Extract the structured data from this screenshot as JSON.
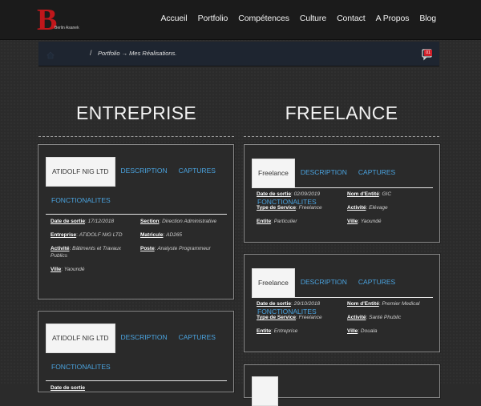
{
  "logo": {
    "mark": "B",
    "text": "Berlin Asanek"
  },
  "nav": [
    "Accueil",
    "Portfolio",
    "Compétences",
    "Culture",
    "Contact",
    "A Propos",
    "Blog"
  ],
  "breadcrumb": {
    "sep": "/",
    "path": "Portfolio → Mes Réalisations.",
    "badge": "01"
  },
  "columns": {
    "left": "ENTREPRISE",
    "right": "FREELANCE"
  },
  "tabs": {
    "enterprise": [
      "ATIDOLF NIG LTD",
      "DESCRIPTION",
      "CAPTURES",
      "FONCTIONALITES"
    ],
    "freelance": [
      "Freelance",
      "DESCRIPTION",
      "CAPTURES",
      "FONCTIONALITES"
    ]
  },
  "enterprise_card_1": {
    "date_label": "Date de sortie",
    "date": "17/12/2018",
    "section_label": "Section",
    "section": "Direction Administrative",
    "entreprise_label": "Entreprise",
    "entreprise": "ATIDOLF NIG LTD",
    "matricule_label": "Matricule",
    "matricule": "AD265",
    "activite_label": "Activité",
    "activite": "Bâtiments et Travaux Publics",
    "poste_label": "Poste",
    "poste": "Analyste Programmeur",
    "ville_label": "Ville",
    "ville": "Yaoundé"
  },
  "enterprise_card_2": {
    "date_label": "Date de sortie"
  },
  "freelance_card_1": {
    "date_label": "Date de sortie",
    "date": "02/09/2019",
    "nom_label": "Nom d'Entité",
    "nom": "GIC",
    "type_label": "Type de Service",
    "type": "Freelance",
    "activite_label": "Activité",
    "activite": "Elévage",
    "entite_label": "Entite",
    "entite": "Particulier",
    "ville_label": "Ville",
    "ville": "Yaoundé"
  },
  "freelance_card_2": {
    "date_label": "Date de sortie",
    "date": "29/10/2018",
    "nom_label": "Nom d'Entité",
    "nom": "Premier Medical",
    "type_label": "Type de Service",
    "type": "Freelance",
    "activite_label": "Activité",
    "activite": "Santé Phublic",
    "entite_label": "Entite",
    "entite": "Entreprise",
    "ville_label": "Ville",
    "ville": "Douala"
  },
  "colors": {
    "nav_bg": "#1b1b1b",
    "logo_red": "#c0171b",
    "tab_link": "#4aa3df",
    "badge_red": "#d0202a"
  }
}
